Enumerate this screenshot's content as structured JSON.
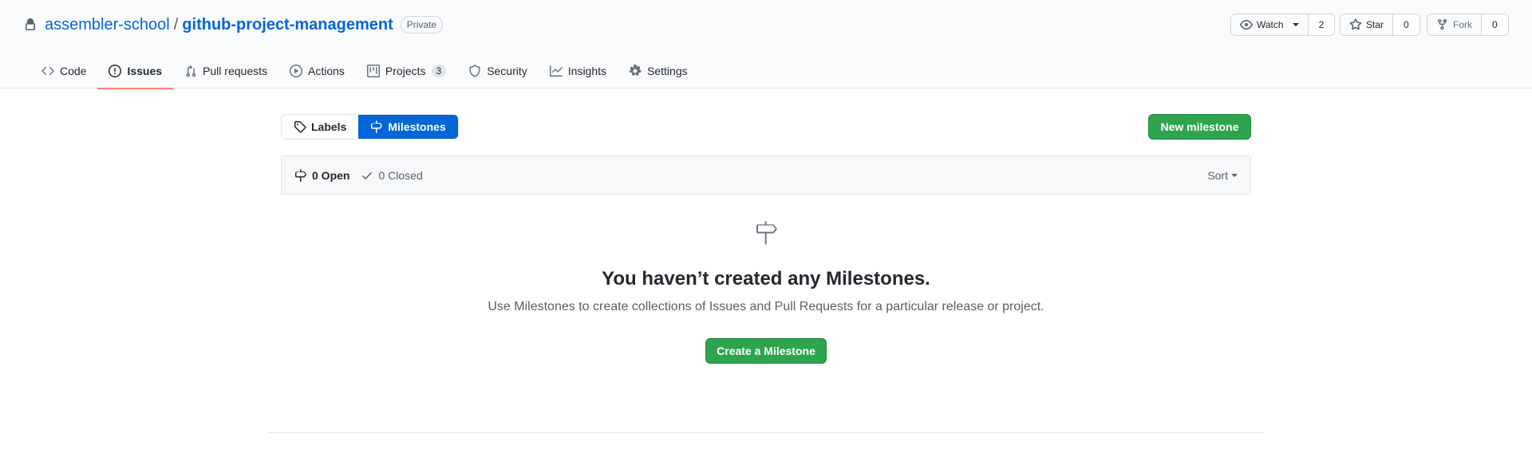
{
  "repo": {
    "owner": "assembler-school",
    "separator": "/",
    "name": "github-project-management",
    "visibility": "Private"
  },
  "repo_actions": {
    "watch": {
      "label": "Watch",
      "count": "2"
    },
    "star": {
      "label": "Star",
      "count": "0"
    },
    "fork": {
      "label": "Fork",
      "count": "0"
    }
  },
  "tabs": [
    {
      "label": "Code",
      "icon": "code-icon"
    },
    {
      "label": "Issues",
      "icon": "issue-opened-icon",
      "active": true
    },
    {
      "label": "Pull requests",
      "icon": "git-pull-request-icon"
    },
    {
      "label": "Actions",
      "icon": "play-icon"
    },
    {
      "label": "Projects",
      "icon": "project-icon",
      "counter": "3"
    },
    {
      "label": "Security",
      "icon": "shield-icon"
    },
    {
      "label": "Insights",
      "icon": "graph-icon"
    },
    {
      "label": "Settings",
      "icon": "gear-icon"
    }
  ],
  "subnav": {
    "labels": "Labels",
    "milestones": "Milestones"
  },
  "new_milestone_label": "New milestone",
  "states": {
    "open": "0 Open",
    "closed": "0 Closed"
  },
  "sort_label": "Sort",
  "blankslate": {
    "title": "You haven’t created any Milestones.",
    "description": "Use Milestones to create collections of Issues and Pull Requests for a particular release or project.",
    "button": "Create a Milestone"
  },
  "colors": {
    "accent": "#0366d6",
    "primary_button": "#2ea44f",
    "active_tab_underline": "#f9826c"
  }
}
